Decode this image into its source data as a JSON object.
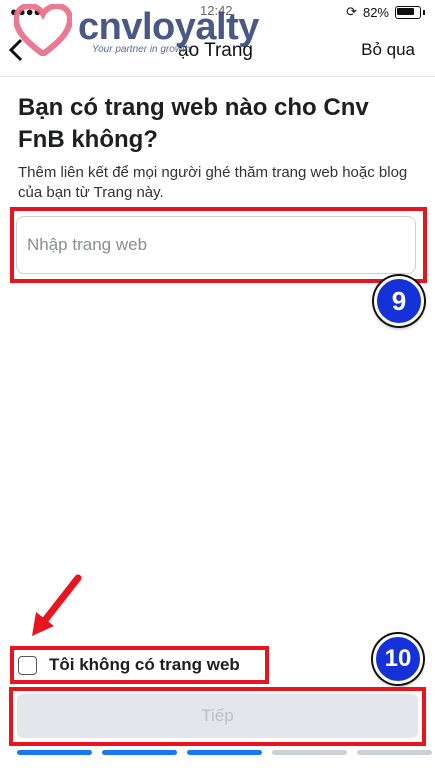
{
  "status_bar": {
    "time": "12:42",
    "battery": "82%",
    "icons": [
      "signal-icon",
      "wifi-icon",
      "orientation-lock-icon",
      "battery-icon"
    ]
  },
  "watermark": {
    "name": "cnvloyalty",
    "tagline": "Your partner in growth"
  },
  "nav": {
    "back_icon": "chevron-left-icon",
    "title": "ạo Trang",
    "skip_label": "Bỏ qua"
  },
  "page": {
    "heading": "Bạn có trang web nào cho Cnv FnB không?",
    "description": "Thêm liên kết để mọi người ghé thăm trang web hoặc blog của bạn từ Trang này."
  },
  "website_input": {
    "value": "",
    "placeholder": "Nhập trang web"
  },
  "no_website": {
    "checked": false,
    "label": "Tôi không có trang web"
  },
  "next_button": {
    "label": "Tiếp",
    "enabled": false
  },
  "progress": {
    "total_steps": 5,
    "completed_steps": 3,
    "active_color": "#1877f2",
    "inactive_color": "#ccd0d5"
  },
  "annotations": {
    "step_9": "9",
    "step_10": "10",
    "highlight_color": "#e8141f",
    "badge_color": "#1532d8"
  }
}
